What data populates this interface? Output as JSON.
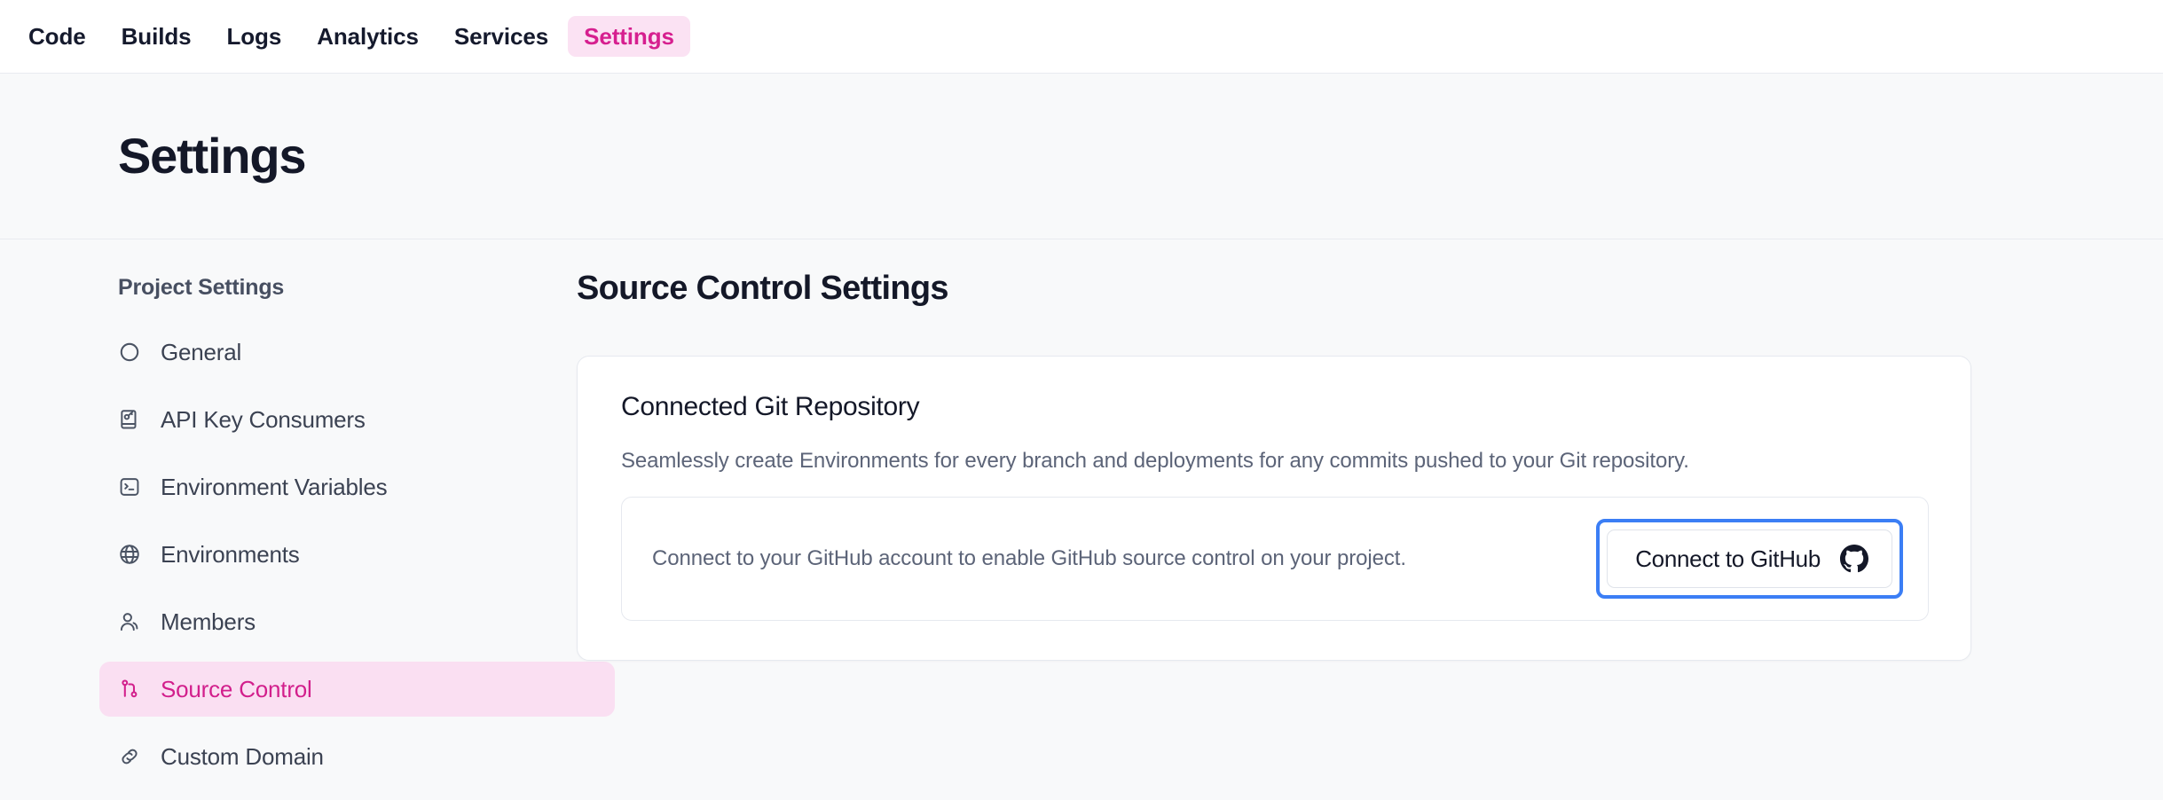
{
  "topnav": {
    "tabs": [
      {
        "label": "Code",
        "active": false
      },
      {
        "label": "Builds",
        "active": false
      },
      {
        "label": "Logs",
        "active": false
      },
      {
        "label": "Analytics",
        "active": false
      },
      {
        "label": "Services",
        "active": false
      },
      {
        "label": "Settings",
        "active": true
      }
    ]
  },
  "header": {
    "title": "Settings"
  },
  "sidebar": {
    "heading": "Project Settings",
    "items": [
      {
        "label": "General",
        "icon": "circle-icon",
        "active": false
      },
      {
        "label": "API Key Consumers",
        "icon": "key-book-icon",
        "active": false
      },
      {
        "label": "Environment Variables",
        "icon": "terminal-icon",
        "active": false
      },
      {
        "label": "Environments",
        "icon": "globe-icon",
        "active": false
      },
      {
        "label": "Members",
        "icon": "user-icon",
        "active": false
      },
      {
        "label": "Source Control",
        "icon": "git-branch-icon",
        "active": true
      },
      {
        "label": "Custom Domain",
        "icon": "link-icon",
        "active": false
      }
    ]
  },
  "main": {
    "section_title": "Source Control Settings",
    "card": {
      "title": "Connected Git Repository",
      "description": "Seamlessly create Environments for every branch and deployments for any commits pushed to your Git repository.",
      "panel": {
        "text": "Connect to your GitHub account to enable GitHub source control on your project.",
        "button_label": "Connect to GitHub",
        "button_icon": "github-icon",
        "button_focused": true
      }
    }
  },
  "colors": {
    "accent_pink": "#d21f8c",
    "accent_pink_bg": "#fadff2",
    "focus_blue": "#3b7ef5",
    "page_bg": "#f8f9fa",
    "text_dark": "#141828",
    "text_muted": "#5c6478",
    "border": "#e6e9ef"
  }
}
